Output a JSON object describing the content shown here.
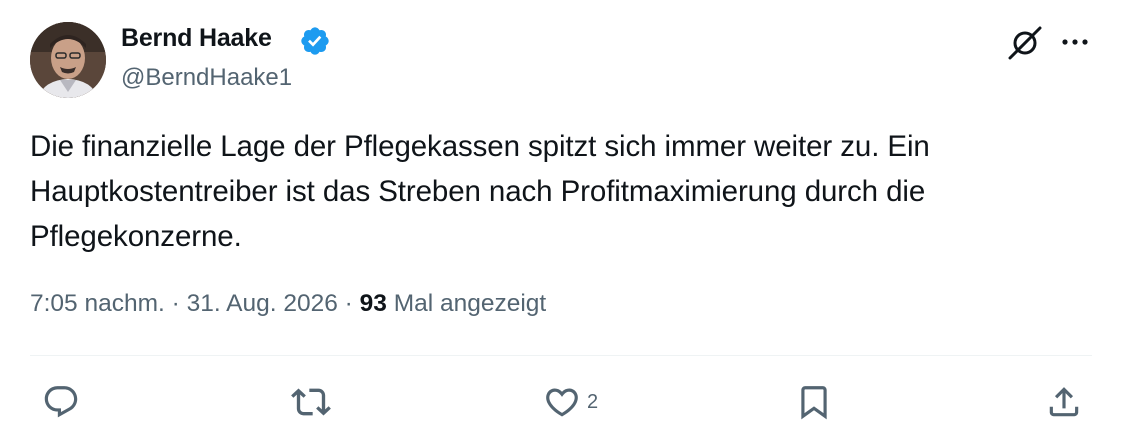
{
  "author": {
    "display_name": "Bernd Haake",
    "handle": "@BerndHaake1",
    "verified": true
  },
  "tweet": {
    "text": "Die finanzielle Lage der Pflegekassen spitzt sich immer weiter zu. Ein Hauptkostentreiber ist das Streben nach Profitmaximierung durch die Pflegekonzerne.",
    "time": "7:05 nachm.",
    "separator": "·",
    "date": "31. Aug. 2026",
    "views_count": "93",
    "views_label": "Mal angezeigt"
  },
  "actions": {
    "reply_count": "",
    "repost_count": "",
    "like_count": "2",
    "bookmark_count": ""
  },
  "icons": {
    "header": [
      "grok-icon",
      "more-icon"
    ],
    "actions": [
      "reply-icon",
      "repost-icon",
      "like-icon",
      "bookmark-icon",
      "share-icon"
    ]
  },
  "colors": {
    "text_primary": "#0f1419",
    "text_secondary": "#536471",
    "verified_blue": "#1d9bf0",
    "divider": "#eff3f4"
  }
}
